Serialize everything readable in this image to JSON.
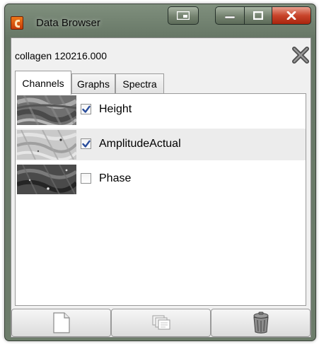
{
  "window": {
    "title": "Data Browser",
    "icon": "app-logo-icon",
    "controls": [
      "snap-icon",
      "minimize-icon",
      "maximize-icon",
      "close-icon"
    ]
  },
  "file": {
    "name": "collagen 120216.000",
    "close_icon": "close-x-icon"
  },
  "tabs": [
    {
      "label": "Channels",
      "active": true
    },
    {
      "label": "Graphs",
      "active": false
    },
    {
      "label": "Spectra",
      "active": false
    }
  ],
  "channels": [
    {
      "label": "Height",
      "checked": true
    },
    {
      "label": "AmplitudeActual",
      "checked": true
    },
    {
      "label": "Phase",
      "checked": false
    }
  ],
  "toolbar": {
    "buttons": [
      "new-document-icon",
      "duplicate-icon",
      "trash-icon"
    ]
  },
  "colors": {
    "title_bar": "#6d7d6b",
    "close_button": "#c8442b",
    "checkmark": "#2a4d9b",
    "row_alt": "#ececec"
  }
}
